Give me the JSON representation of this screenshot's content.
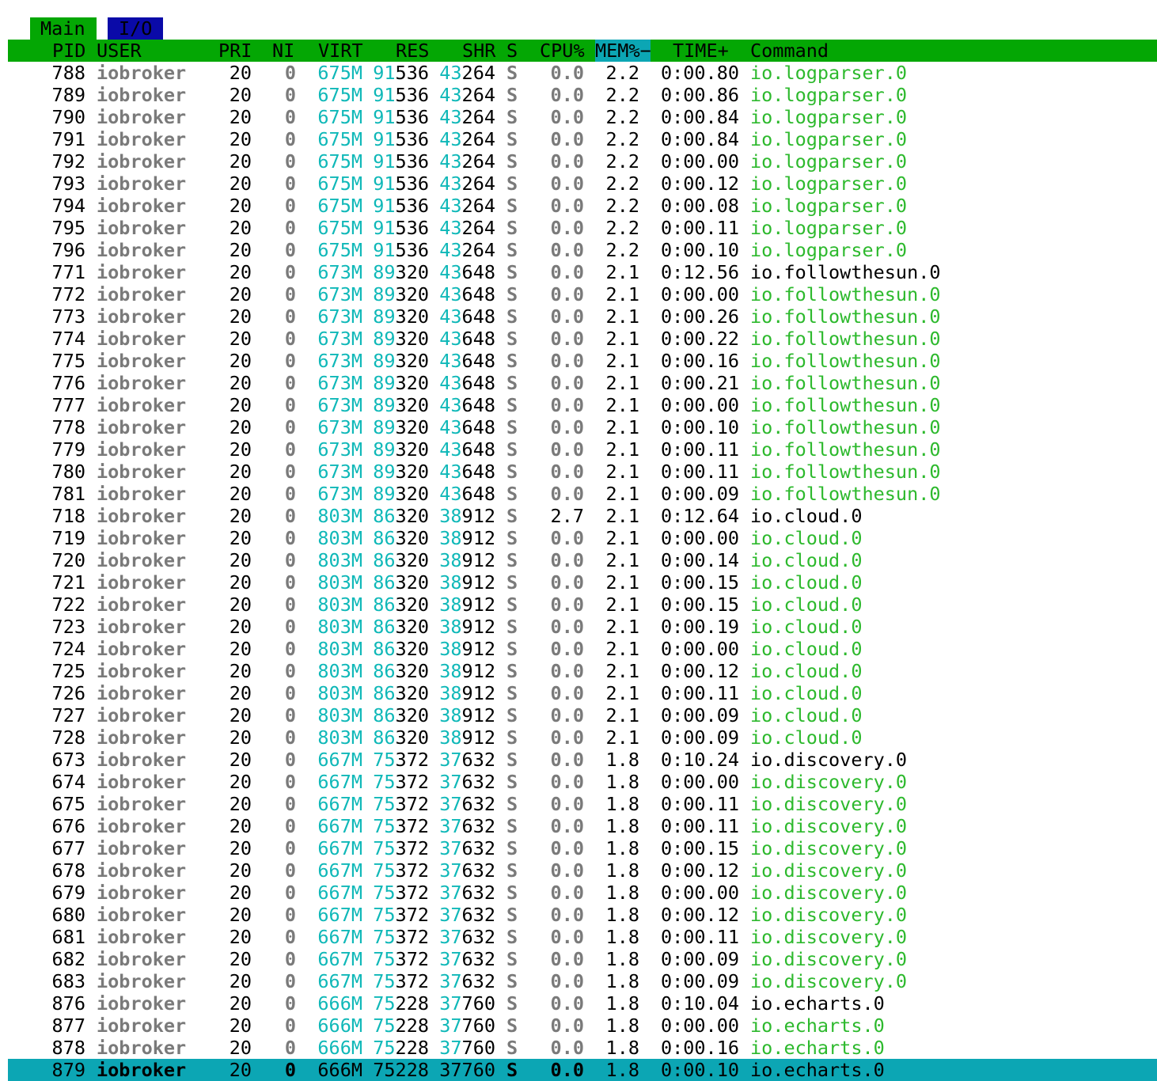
{
  "tabs": [
    "Main",
    "I/O"
  ],
  "header": [
    "PID",
    "USER",
    "PRI",
    "NI",
    "VIRT",
    "RES",
    "SHR",
    "S",
    "CPU%",
    "MEM%−",
    "TIME+",
    "Command"
  ],
  "rows": [
    {
      "pid": "788",
      "user": "iobroker",
      "pri": "20",
      "ni": "0",
      "virt": "675M",
      "res": "91536",
      "shr": "43264",
      "s": "S",
      "cpu": "0.0",
      "mem": "2.2",
      "time": "0:00.80",
      "cmd": "io.logparser.0",
      "thread": true
    },
    {
      "pid": "789",
      "user": "iobroker",
      "pri": "20",
      "ni": "0",
      "virt": "675M",
      "res": "91536",
      "shr": "43264",
      "s": "S",
      "cpu": "0.0",
      "mem": "2.2",
      "time": "0:00.86",
      "cmd": "io.logparser.0",
      "thread": true
    },
    {
      "pid": "790",
      "user": "iobroker",
      "pri": "20",
      "ni": "0",
      "virt": "675M",
      "res": "91536",
      "shr": "43264",
      "s": "S",
      "cpu": "0.0",
      "mem": "2.2",
      "time": "0:00.84",
      "cmd": "io.logparser.0",
      "thread": true
    },
    {
      "pid": "791",
      "user": "iobroker",
      "pri": "20",
      "ni": "0",
      "virt": "675M",
      "res": "91536",
      "shr": "43264",
      "s": "S",
      "cpu": "0.0",
      "mem": "2.2",
      "time": "0:00.84",
      "cmd": "io.logparser.0",
      "thread": true
    },
    {
      "pid": "792",
      "user": "iobroker",
      "pri": "20",
      "ni": "0",
      "virt": "675M",
      "res": "91536",
      "shr": "43264",
      "s": "S",
      "cpu": "0.0",
      "mem": "2.2",
      "time": "0:00.00",
      "cmd": "io.logparser.0",
      "thread": true
    },
    {
      "pid": "793",
      "user": "iobroker",
      "pri": "20",
      "ni": "0",
      "virt": "675M",
      "res": "91536",
      "shr": "43264",
      "s": "S",
      "cpu": "0.0",
      "mem": "2.2",
      "time": "0:00.12",
      "cmd": "io.logparser.0",
      "thread": true
    },
    {
      "pid": "794",
      "user": "iobroker",
      "pri": "20",
      "ni": "0",
      "virt": "675M",
      "res": "91536",
      "shr": "43264",
      "s": "S",
      "cpu": "0.0",
      "mem": "2.2",
      "time": "0:00.08",
      "cmd": "io.logparser.0",
      "thread": true
    },
    {
      "pid": "795",
      "user": "iobroker",
      "pri": "20",
      "ni": "0",
      "virt": "675M",
      "res": "91536",
      "shr": "43264",
      "s": "S",
      "cpu": "0.0",
      "mem": "2.2",
      "time": "0:00.11",
      "cmd": "io.logparser.0",
      "thread": true
    },
    {
      "pid": "796",
      "user": "iobroker",
      "pri": "20",
      "ni": "0",
      "virt": "675M",
      "res": "91536",
      "shr": "43264",
      "s": "S",
      "cpu": "0.0",
      "mem": "2.2",
      "time": "0:00.10",
      "cmd": "io.logparser.0",
      "thread": true
    },
    {
      "pid": "771",
      "user": "iobroker",
      "pri": "20",
      "ni": "0",
      "virt": "673M",
      "res": "89320",
      "shr": "43648",
      "s": "S",
      "cpu": "0.0",
      "mem": "2.1",
      "time": "0:12.56",
      "cmd": "io.followthesun.0",
      "thread": false
    },
    {
      "pid": "772",
      "user": "iobroker",
      "pri": "20",
      "ni": "0",
      "virt": "673M",
      "res": "89320",
      "shr": "43648",
      "s": "S",
      "cpu": "0.0",
      "mem": "2.1",
      "time": "0:00.00",
      "cmd": "io.followthesun.0",
      "thread": true
    },
    {
      "pid": "773",
      "user": "iobroker",
      "pri": "20",
      "ni": "0",
      "virt": "673M",
      "res": "89320",
      "shr": "43648",
      "s": "S",
      "cpu": "0.0",
      "mem": "2.1",
      "time": "0:00.26",
      "cmd": "io.followthesun.0",
      "thread": true
    },
    {
      "pid": "774",
      "user": "iobroker",
      "pri": "20",
      "ni": "0",
      "virt": "673M",
      "res": "89320",
      "shr": "43648",
      "s": "S",
      "cpu": "0.0",
      "mem": "2.1",
      "time": "0:00.22",
      "cmd": "io.followthesun.0",
      "thread": true
    },
    {
      "pid": "775",
      "user": "iobroker",
      "pri": "20",
      "ni": "0",
      "virt": "673M",
      "res": "89320",
      "shr": "43648",
      "s": "S",
      "cpu": "0.0",
      "mem": "2.1",
      "time": "0:00.16",
      "cmd": "io.followthesun.0",
      "thread": true
    },
    {
      "pid": "776",
      "user": "iobroker",
      "pri": "20",
      "ni": "0",
      "virt": "673M",
      "res": "89320",
      "shr": "43648",
      "s": "S",
      "cpu": "0.0",
      "mem": "2.1",
      "time": "0:00.21",
      "cmd": "io.followthesun.0",
      "thread": true
    },
    {
      "pid": "777",
      "user": "iobroker",
      "pri": "20",
      "ni": "0",
      "virt": "673M",
      "res": "89320",
      "shr": "43648",
      "s": "S",
      "cpu": "0.0",
      "mem": "2.1",
      "time": "0:00.00",
      "cmd": "io.followthesun.0",
      "thread": true
    },
    {
      "pid": "778",
      "user": "iobroker",
      "pri": "20",
      "ni": "0",
      "virt": "673M",
      "res": "89320",
      "shr": "43648",
      "s": "S",
      "cpu": "0.0",
      "mem": "2.1",
      "time": "0:00.10",
      "cmd": "io.followthesun.0",
      "thread": true
    },
    {
      "pid": "779",
      "user": "iobroker",
      "pri": "20",
      "ni": "0",
      "virt": "673M",
      "res": "89320",
      "shr": "43648",
      "s": "S",
      "cpu": "0.0",
      "mem": "2.1",
      "time": "0:00.11",
      "cmd": "io.followthesun.0",
      "thread": true
    },
    {
      "pid": "780",
      "user": "iobroker",
      "pri": "20",
      "ni": "0",
      "virt": "673M",
      "res": "89320",
      "shr": "43648",
      "s": "S",
      "cpu": "0.0",
      "mem": "2.1",
      "time": "0:00.11",
      "cmd": "io.followthesun.0",
      "thread": true
    },
    {
      "pid": "781",
      "user": "iobroker",
      "pri": "20",
      "ni": "0",
      "virt": "673M",
      "res": "89320",
      "shr": "43648",
      "s": "S",
      "cpu": "0.0",
      "mem": "2.1",
      "time": "0:00.09",
      "cmd": "io.followthesun.0",
      "thread": true
    },
    {
      "pid": "718",
      "user": "iobroker",
      "pri": "20",
      "ni": "0",
      "virt": "803M",
      "res": "86320",
      "shr": "38912",
      "s": "S",
      "cpu": "2.7",
      "mem": "2.1",
      "time": "0:12.64",
      "cmd": "io.cloud.0",
      "thread": false
    },
    {
      "pid": "719",
      "user": "iobroker",
      "pri": "20",
      "ni": "0",
      "virt": "803M",
      "res": "86320",
      "shr": "38912",
      "s": "S",
      "cpu": "0.0",
      "mem": "2.1",
      "time": "0:00.00",
      "cmd": "io.cloud.0",
      "thread": true
    },
    {
      "pid": "720",
      "user": "iobroker",
      "pri": "20",
      "ni": "0",
      "virt": "803M",
      "res": "86320",
      "shr": "38912",
      "s": "S",
      "cpu": "0.0",
      "mem": "2.1",
      "time": "0:00.14",
      "cmd": "io.cloud.0",
      "thread": true
    },
    {
      "pid": "721",
      "user": "iobroker",
      "pri": "20",
      "ni": "0",
      "virt": "803M",
      "res": "86320",
      "shr": "38912",
      "s": "S",
      "cpu": "0.0",
      "mem": "2.1",
      "time": "0:00.15",
      "cmd": "io.cloud.0",
      "thread": true
    },
    {
      "pid": "722",
      "user": "iobroker",
      "pri": "20",
      "ni": "0",
      "virt": "803M",
      "res": "86320",
      "shr": "38912",
      "s": "S",
      "cpu": "0.0",
      "mem": "2.1",
      "time": "0:00.15",
      "cmd": "io.cloud.0",
      "thread": true
    },
    {
      "pid": "723",
      "user": "iobroker",
      "pri": "20",
      "ni": "0",
      "virt": "803M",
      "res": "86320",
      "shr": "38912",
      "s": "S",
      "cpu": "0.0",
      "mem": "2.1",
      "time": "0:00.19",
      "cmd": "io.cloud.0",
      "thread": true
    },
    {
      "pid": "724",
      "user": "iobroker",
      "pri": "20",
      "ni": "0",
      "virt": "803M",
      "res": "86320",
      "shr": "38912",
      "s": "S",
      "cpu": "0.0",
      "mem": "2.1",
      "time": "0:00.00",
      "cmd": "io.cloud.0",
      "thread": true
    },
    {
      "pid": "725",
      "user": "iobroker",
      "pri": "20",
      "ni": "0",
      "virt": "803M",
      "res": "86320",
      "shr": "38912",
      "s": "S",
      "cpu": "0.0",
      "mem": "2.1",
      "time": "0:00.12",
      "cmd": "io.cloud.0",
      "thread": true
    },
    {
      "pid": "726",
      "user": "iobroker",
      "pri": "20",
      "ni": "0",
      "virt": "803M",
      "res": "86320",
      "shr": "38912",
      "s": "S",
      "cpu": "0.0",
      "mem": "2.1",
      "time": "0:00.11",
      "cmd": "io.cloud.0",
      "thread": true
    },
    {
      "pid": "727",
      "user": "iobroker",
      "pri": "20",
      "ni": "0",
      "virt": "803M",
      "res": "86320",
      "shr": "38912",
      "s": "S",
      "cpu": "0.0",
      "mem": "2.1",
      "time": "0:00.09",
      "cmd": "io.cloud.0",
      "thread": true
    },
    {
      "pid": "728",
      "user": "iobroker",
      "pri": "20",
      "ni": "0",
      "virt": "803M",
      "res": "86320",
      "shr": "38912",
      "s": "S",
      "cpu": "0.0",
      "mem": "2.1",
      "time": "0:00.09",
      "cmd": "io.cloud.0",
      "thread": true
    },
    {
      "pid": "673",
      "user": "iobroker",
      "pri": "20",
      "ni": "0",
      "virt": "667M",
      "res": "75372",
      "shr": "37632",
      "s": "S",
      "cpu": "0.0",
      "mem": "1.8",
      "time": "0:10.24",
      "cmd": "io.discovery.0",
      "thread": false
    },
    {
      "pid": "674",
      "user": "iobroker",
      "pri": "20",
      "ni": "0",
      "virt": "667M",
      "res": "75372",
      "shr": "37632",
      "s": "S",
      "cpu": "0.0",
      "mem": "1.8",
      "time": "0:00.00",
      "cmd": "io.discovery.0",
      "thread": true
    },
    {
      "pid": "675",
      "user": "iobroker",
      "pri": "20",
      "ni": "0",
      "virt": "667M",
      "res": "75372",
      "shr": "37632",
      "s": "S",
      "cpu": "0.0",
      "mem": "1.8",
      "time": "0:00.11",
      "cmd": "io.discovery.0",
      "thread": true
    },
    {
      "pid": "676",
      "user": "iobroker",
      "pri": "20",
      "ni": "0",
      "virt": "667M",
      "res": "75372",
      "shr": "37632",
      "s": "S",
      "cpu": "0.0",
      "mem": "1.8",
      "time": "0:00.11",
      "cmd": "io.discovery.0",
      "thread": true
    },
    {
      "pid": "677",
      "user": "iobroker",
      "pri": "20",
      "ni": "0",
      "virt": "667M",
      "res": "75372",
      "shr": "37632",
      "s": "S",
      "cpu": "0.0",
      "mem": "1.8",
      "time": "0:00.15",
      "cmd": "io.discovery.0",
      "thread": true
    },
    {
      "pid": "678",
      "user": "iobroker",
      "pri": "20",
      "ni": "0",
      "virt": "667M",
      "res": "75372",
      "shr": "37632",
      "s": "S",
      "cpu": "0.0",
      "mem": "1.8",
      "time": "0:00.12",
      "cmd": "io.discovery.0",
      "thread": true
    },
    {
      "pid": "679",
      "user": "iobroker",
      "pri": "20",
      "ni": "0",
      "virt": "667M",
      "res": "75372",
      "shr": "37632",
      "s": "S",
      "cpu": "0.0",
      "mem": "1.8",
      "time": "0:00.00",
      "cmd": "io.discovery.0",
      "thread": true
    },
    {
      "pid": "680",
      "user": "iobroker",
      "pri": "20",
      "ni": "0",
      "virt": "667M",
      "res": "75372",
      "shr": "37632",
      "s": "S",
      "cpu": "0.0",
      "mem": "1.8",
      "time": "0:00.12",
      "cmd": "io.discovery.0",
      "thread": true
    },
    {
      "pid": "681",
      "user": "iobroker",
      "pri": "20",
      "ni": "0",
      "virt": "667M",
      "res": "75372",
      "shr": "37632",
      "s": "S",
      "cpu": "0.0",
      "mem": "1.8",
      "time": "0:00.11",
      "cmd": "io.discovery.0",
      "thread": true
    },
    {
      "pid": "682",
      "user": "iobroker",
      "pri": "20",
      "ni": "0",
      "virt": "667M",
      "res": "75372",
      "shr": "37632",
      "s": "S",
      "cpu": "0.0",
      "mem": "1.8",
      "time": "0:00.09",
      "cmd": "io.discovery.0",
      "thread": true
    },
    {
      "pid": "683",
      "user": "iobroker",
      "pri": "20",
      "ni": "0",
      "virt": "667M",
      "res": "75372",
      "shr": "37632",
      "s": "S",
      "cpu": "0.0",
      "mem": "1.8",
      "time": "0:00.09",
      "cmd": "io.discovery.0",
      "thread": true
    },
    {
      "pid": "876",
      "user": "iobroker",
      "pri": "20",
      "ni": "0",
      "virt": "666M",
      "res": "75228",
      "shr": "37760",
      "s": "S",
      "cpu": "0.0",
      "mem": "1.8",
      "time": "0:10.04",
      "cmd": "io.echarts.0",
      "thread": false
    },
    {
      "pid": "877",
      "user": "iobroker",
      "pri": "20",
      "ni": "0",
      "virt": "666M",
      "res": "75228",
      "shr": "37760",
      "s": "S",
      "cpu": "0.0",
      "mem": "1.8",
      "time": "0:00.00",
      "cmd": "io.echarts.0",
      "thread": true
    },
    {
      "pid": "878",
      "user": "iobroker",
      "pri": "20",
      "ni": "0",
      "virt": "666M",
      "res": "75228",
      "shr": "37760",
      "s": "S",
      "cpu": "0.0",
      "mem": "1.8",
      "time": "0:00.16",
      "cmd": "io.echarts.0",
      "thread": true
    },
    {
      "pid": "879",
      "user": "iobroker",
      "pri": "20",
      "ni": "0",
      "virt": "666M",
      "res": "75228",
      "shr": "37760",
      "s": "S",
      "cpu": "0.0",
      "mem": "1.8",
      "time": "0:00.10",
      "cmd": "io.echarts.0",
      "thread": true,
      "selected": true
    }
  ],
  "colors": {
    "header_bg": "#04a704",
    "sorted_col_bg": "#0ca6b4",
    "selected_row_bg": "#0ca6b4",
    "io_tab_bg": "#0a0aa8",
    "dim_text": "#7a7a7a",
    "cyan_text": "#0fb8b8",
    "thread_text": "#2db92d"
  }
}
